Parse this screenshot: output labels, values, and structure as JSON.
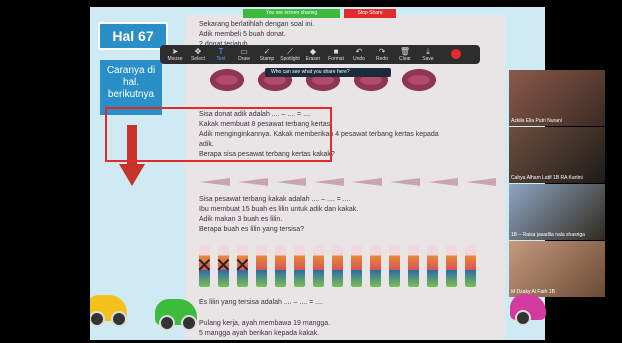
{
  "slide": {
    "page_label": "Hal 67",
    "hint_text": "Caranya di hal. berikutnya"
  },
  "share_bar": {
    "status_text": "You are screen sharing",
    "stop_label": "Stop Share"
  },
  "annotation_toolbar": {
    "tools": [
      "Mouse",
      "Select",
      "Text",
      "Draw",
      "Stamp",
      "Spotlight",
      "Eraser",
      "Format",
      "Undo",
      "Redo",
      "Clear",
      "Save"
    ],
    "banner_text": "Who can see what you share here?"
  },
  "worksheet": {
    "lines_top": [
      "Sekarang berlatihlah dengan soal ini.",
      "Adik membeli 5 buah donat.",
      "2 donat terjatuh."
    ],
    "donut_question": "Sisa donat adik adalah .... – .... = ....",
    "highlighted_problem": [
      "Kakak membuat 8 pesawat terbang kertas.",
      "Adik menginginkannya. Kakak memberikan 4 pesawat terbang kertas kepada",
      "adik.",
      "Berapa sisa pesawat terbang kertas kakak?"
    ],
    "plane_question": [
      "Sisa pesawat terbang kakak adalah .... – .... = ....",
      "Ibu membuat 15 buah es lilin untuk adik dan kakak.",
      "Adik makan 3 buah es lilin.",
      "Berapa buah es lilin yang tersisa?"
    ],
    "popsicle_answer": "Es lilin yang tersisa adalah .... – .... = ....",
    "bottom_lines": [
      "Pulang kerja, ayah membawa 19 mangga.",
      "5 mangga ayah berikan kepada kakak."
    ]
  },
  "participants": [
    {
      "name": "Azkila Elia Putri Nurani"
    },
    {
      "name": "Cahya Alham Latif 1B RA Kartini"
    },
    {
      "name": "1B – Raisa jasadila nala shasriga"
    },
    {
      "name": "M Dzaky Al Fath 1B"
    }
  ],
  "colors": {
    "slide_bg": "#cfeaf2",
    "accent_blue": "#2b8fc7",
    "highlight_red": "#e12a2a",
    "share_green": "#3dba3d",
    "stop_red": "#e22b2b"
  }
}
